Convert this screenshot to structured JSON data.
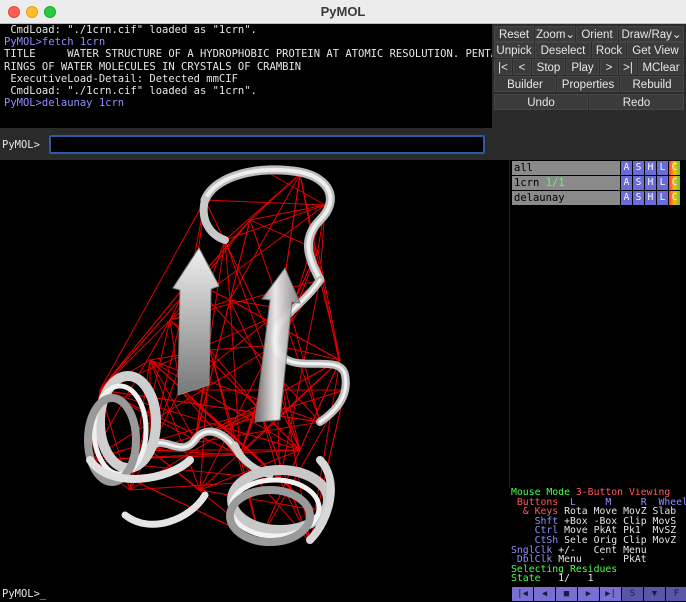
{
  "window": {
    "title": "PyMOL"
  },
  "console": {
    "lines": [
      {
        "text": " CmdLoad: \"./1crn.cif\" loaded as \"1crn\".",
        "type": "out"
      },
      {
        "text": "PyMOL>fetch 1crn",
        "type": "prompt"
      },
      {
        "text": "TITLE     WATER STRUCTURE OF A HYDROPHOBIC PROTEIN AT ATOMIC RESOLUTION. PENTAGON",
        "type": "out"
      },
      {
        "text": "RINGS OF WATER MOLECULES IN CRYSTALS OF CRAMBIN",
        "type": "out"
      },
      {
        "text": " ExecutiveLoad-Detail: Detected mmCIF",
        "type": "out"
      },
      {
        "text": " CmdLoad: \"./1crn.cif\" loaded as \"1crn\".",
        "type": "out"
      },
      {
        "text": "PyMOL>delaunay 1crn",
        "type": "prompt"
      }
    ]
  },
  "command": {
    "prompt": "PyMOL>",
    "value": ""
  },
  "buttons": {
    "row1": [
      "Reset",
      "Zoom",
      "Orient",
      "Draw/Ray"
    ],
    "row2": [
      "Unpick",
      "Deselect",
      "Rock",
      "Get View"
    ],
    "row3": [
      "|<",
      "<",
      "Stop",
      "Play",
      ">",
      ">|",
      "MClear"
    ],
    "row4": [
      "Builder",
      "Properties",
      "Rebuild"
    ],
    "row5": [
      "Undo",
      "Redo"
    ],
    "dropdown_arrow": "⌄"
  },
  "objects": [
    {
      "name": "all",
      "state": ""
    },
    {
      "name": "1crn",
      "state": "1/1"
    },
    {
      "name": "delaunay",
      "state": ""
    }
  ],
  "object_buttons": [
    "A",
    "S",
    "H",
    "L",
    "C"
  ],
  "mouse": {
    "title_a": "Mouse Mode ",
    "title_b": "3-Button Viewing",
    "buttons_label": " Buttons",
    "buttons_cols": "  L     M     R  Wheel",
    "keys_label": "  & Keys",
    "keys_vals": " Rota Move MovZ Slab",
    "shft_label": "    Shft",
    "shft_vals": " +Box -Box Clip MovS",
    "ctrl_label": "    Ctrl",
    "ctrl_vals": " Move PkAt Pk1  MvSZ",
    "ctsh_label": "    CtSh",
    "ctsh_vals": " Sele Orig Clip MovZ",
    "sngl_label": "SnglClk",
    "sngl_vals": " +/-   Cent Menu",
    "dbl_label": " DblClk",
    "dbl_vals": " Menu   -   PkAt",
    "selecting_a": "Selecting ",
    "selecting_b": "Residues",
    "state_label": "State",
    "state_vals": "   1/   1"
  },
  "bottom": {
    "prompt": "PyMOL>_",
    "transport": [
      "|◀",
      "◀",
      "■",
      "▶",
      "▶|",
      "S",
      "▼",
      "F"
    ]
  }
}
